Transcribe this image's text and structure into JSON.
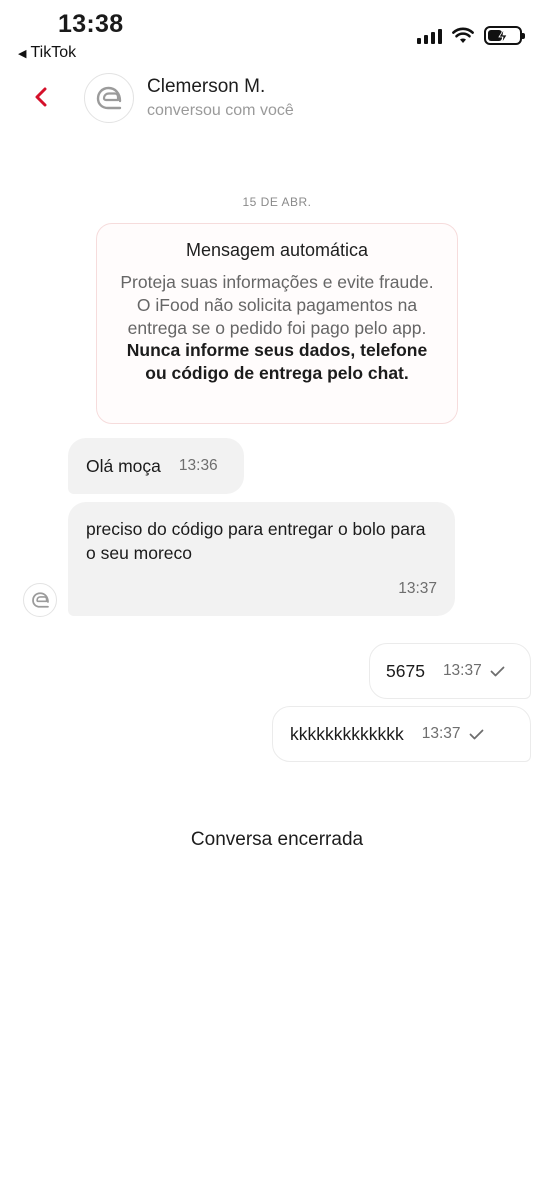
{
  "status_bar": {
    "time": "13:38",
    "back_app": "TikTok"
  },
  "header": {
    "back_icon": "chevron-left-icon",
    "accent_color": "#d5102a",
    "name": "Clemerson M.",
    "subtitle": "conversou com você"
  },
  "chat": {
    "date": "15 DE ABR.",
    "auto_message": {
      "title": "Mensagem automática",
      "body_plain": "Proteja suas informações e evite fraude. O iFood não solicita pagamentos na entrega se o pedido foi pago pelo app.",
      "body_bold": "Nunca informe seus dados, telefone ou código de entrega pelo chat."
    },
    "messages": [
      {
        "direction": "incoming",
        "text": "Olá moça",
        "time": "13:36"
      },
      {
        "direction": "incoming",
        "text": "preciso do código para entregar o bolo para o seu moreco",
        "time": "13:37"
      },
      {
        "direction": "outgoing",
        "text": "5675",
        "time": "13:37",
        "status_icon": "check-icon"
      },
      {
        "direction": "outgoing",
        "text": "kkkkkkkkkkkkk",
        "time": "13:37",
        "status_icon": "check-icon"
      }
    ],
    "closed_label": "Conversa encerrada"
  }
}
